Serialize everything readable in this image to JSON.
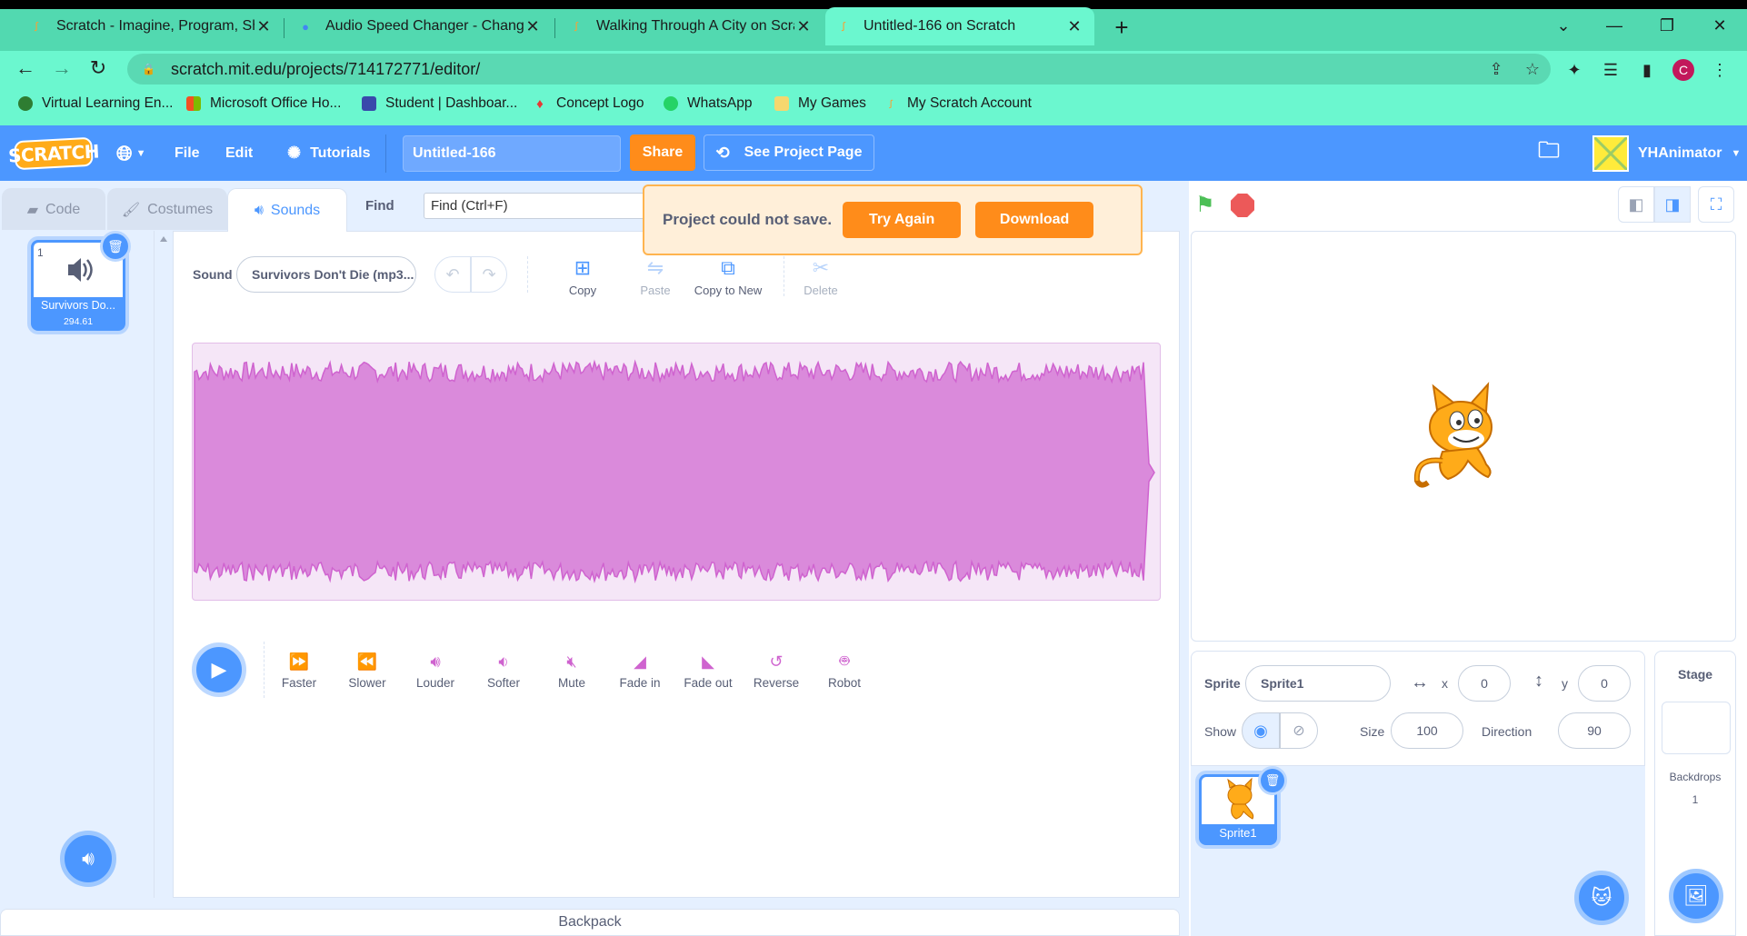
{
  "browser": {
    "tabs": [
      {
        "title": "Scratch - Imagine, Program, Share",
        "active": false
      },
      {
        "title": "Audio Speed Changer - Change T",
        "active": false
      },
      {
        "title": "Walking Through A City on Scratch",
        "active": false
      },
      {
        "title": "Untitled-166 on Scratch",
        "active": true
      }
    ],
    "new_tab": "+",
    "url": "scratch.mit.edu/projects/714172771/editor/",
    "profile_initial": "C",
    "bookmarks": [
      {
        "label": "Virtual Learning En...",
        "icon": "vle-icon"
      },
      {
        "label": "Microsoft Office Ho...",
        "icon": "microsoft-icon"
      },
      {
        "label": "Student | Dashboar...",
        "icon": "shield-icon"
      },
      {
        "label": "Concept Logo",
        "icon": "flame-icon"
      },
      {
        "label": "WhatsApp",
        "icon": "whatsapp-icon"
      },
      {
        "label": "My Games",
        "icon": "folder-icon"
      },
      {
        "label": "My Scratch Account",
        "icon": "scratch-icon"
      }
    ]
  },
  "menubar": {
    "logo": "SCRATCH",
    "file": "File",
    "edit": "Edit",
    "tutorials": "Tutorials",
    "project_title": "Untitled-166",
    "share": "Share",
    "see_project_page": "See Project Page",
    "username": "YHAnimator"
  },
  "editor_tabs": {
    "code": "Code",
    "costumes": "Costumes",
    "sounds": "Sounds",
    "active": "sounds"
  },
  "find": {
    "label": "Find",
    "placeholder": "Find (Ctrl+F)"
  },
  "alert": {
    "message": "Project could not save.",
    "try_again": "Try Again",
    "download": "Download"
  },
  "sound_list": [
    {
      "index": "1",
      "name": "Survivors Do...",
      "duration": "294.61"
    }
  ],
  "sound_editor": {
    "sound_label": "Sound",
    "sound_name": "Survivors Don't Die (mp3...",
    "tools": {
      "copy": "Copy",
      "paste": "Paste",
      "copy_to_new": "Copy to New",
      "delete": "Delete"
    },
    "effects": [
      "Faster",
      "Slower",
      "Louder",
      "Softer",
      "Mute",
      "Fade in",
      "Fade out",
      "Reverse",
      "Robot"
    ],
    "waveform_color": "#cf63cf"
  },
  "backpack": "Backpack",
  "sprite_info": {
    "sprite_label": "Sprite",
    "sprite_name": "Sprite1",
    "x_label": "x",
    "x": "0",
    "y_label": "y",
    "y": "0",
    "show_label": "Show",
    "size_label": "Size",
    "size": "100",
    "direction_label": "Direction",
    "direction": "90"
  },
  "sprites": [
    {
      "name": "Sprite1"
    }
  ],
  "stage_panel": {
    "title": "Stage",
    "backdrops_label": "Backdrops",
    "backdrops_count": "1"
  },
  "colors": {
    "scratch_blue": "#4c97ff",
    "orange": "#ff8c1a",
    "sound_purple": "#cf63cf",
    "chrome_green": "#6bf7cf"
  }
}
